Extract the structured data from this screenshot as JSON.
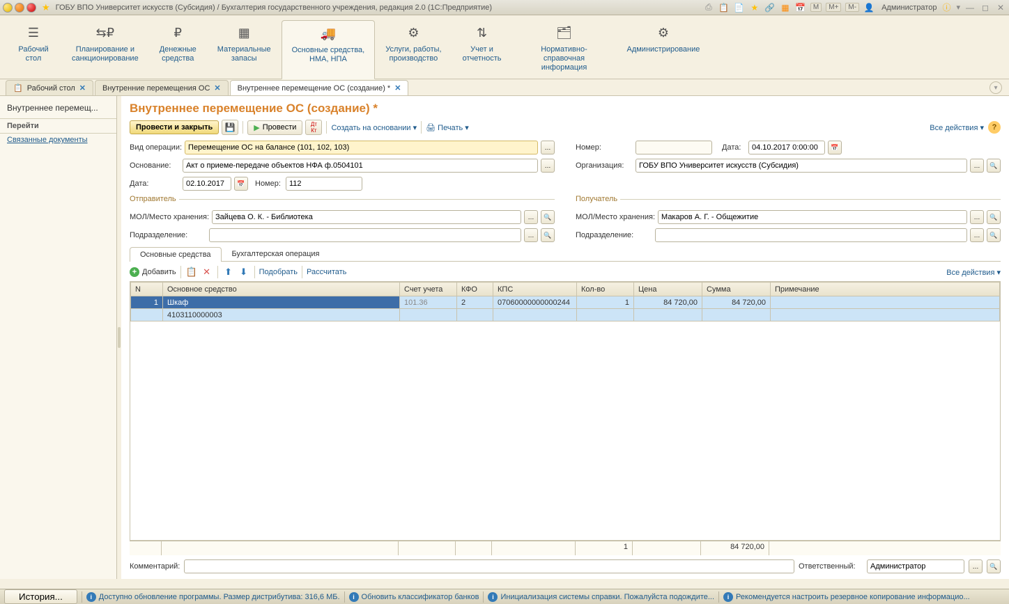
{
  "titlebar": {
    "title": "ГОБУ ВПО Университет искусств (Субсидия) / Бухгалтерия государственного учреждения, редакция 2.0  (1С:Предприятие)",
    "user": "Администратор",
    "m_buttons": [
      "М",
      "М+",
      "М-"
    ]
  },
  "sections": [
    {
      "label": "Рабочий\nстол"
    },
    {
      "label": "Планирование и\nсанкционирование"
    },
    {
      "label": "Денежные\nсредства"
    },
    {
      "label": "Материальные\nзапасы"
    },
    {
      "label": "Основные средства,\nНМА, НПА"
    },
    {
      "label": "Услуги, работы,\nпроизводство"
    },
    {
      "label": "Учет и\nотчетность"
    },
    {
      "label": "Нормативно-справочная\nинформация"
    },
    {
      "label": "Администрирование"
    }
  ],
  "tabs": [
    {
      "label": "Рабочий стол"
    },
    {
      "label": "Внутренние перемещения ОС"
    },
    {
      "label": "Внутреннее перемещение ОС (создание) *"
    }
  ],
  "nav": {
    "title": "Внутреннее перемещ...",
    "links": [
      "Перейти",
      "Связанные документы"
    ]
  },
  "page": {
    "title": "Внутреннее перемещение ОС (создание) *",
    "toolbar": {
      "post_close": "Провести и закрыть",
      "post": "Провести",
      "create_based": "Создать на основании",
      "print": "Печать",
      "all_actions": "Все действия"
    },
    "fields": {
      "op_type_label": "Вид операции:",
      "op_type": "Перемещение ОС на балансе (101, 102, 103)",
      "base_label": "Основание:",
      "base": "Акт о приеме-передаче объектов НФА ф.0504101",
      "date_label": "Дата:",
      "date": "02.10.2017",
      "num_label": "Номер:",
      "num": "112",
      "number_label": "Номер:",
      "number": "",
      "date2_label": "Дата:",
      "date2": "04.10.2017 0:00:00",
      "org_label": "Организация:",
      "org": "ГОБУ ВПО Университет искусств (Субсидия)",
      "sender_title": "Отправитель",
      "receiver_title": "Получатель",
      "mol_label": "МОЛ/Место хранения:",
      "sender_mol": "Зайцева О. К. - Библиотека",
      "receiver_mol": "Макаров А. Г. - Общежитие",
      "dept_label": "Подразделение:",
      "sender_dept": "",
      "receiver_dept": ""
    },
    "inner_tabs": [
      "Основные средства",
      "Бухгалтерская операция"
    ],
    "table_toolbar": {
      "add": "Добавить",
      "select": "Подобрать",
      "calc": "Рассчитать",
      "all_actions": "Все действия"
    },
    "columns": [
      "N",
      "Основное средство",
      "Счет учета",
      "КФО",
      "КПС",
      "Кол-во",
      "Цена",
      "Сумма",
      "Примечание"
    ],
    "rows": [
      {
        "n": "1",
        "name": "Шкаф",
        "code": "4103110000003",
        "account": "101.36",
        "kfo": "2",
        "kps": "07060000000000244",
        "qty": "1",
        "price": "84 720,00",
        "sum": "84 720,00",
        "note": ""
      }
    ],
    "totals": {
      "qty": "1",
      "sum": "84 720,00"
    },
    "comment_label": "Комментарий:",
    "comment": "",
    "resp_label": "Ответственный:",
    "resp": "Администратор"
  },
  "statusbar": {
    "history": "История...",
    "items": [
      "Доступно обновление программы. Размер дистрибутива: 316,6 МБ.",
      "Обновить классификатор банков",
      "Инициализация системы справки. Пожалуйста подождите...",
      "Рекомендуется настроить резервное копирование информацио..."
    ]
  }
}
